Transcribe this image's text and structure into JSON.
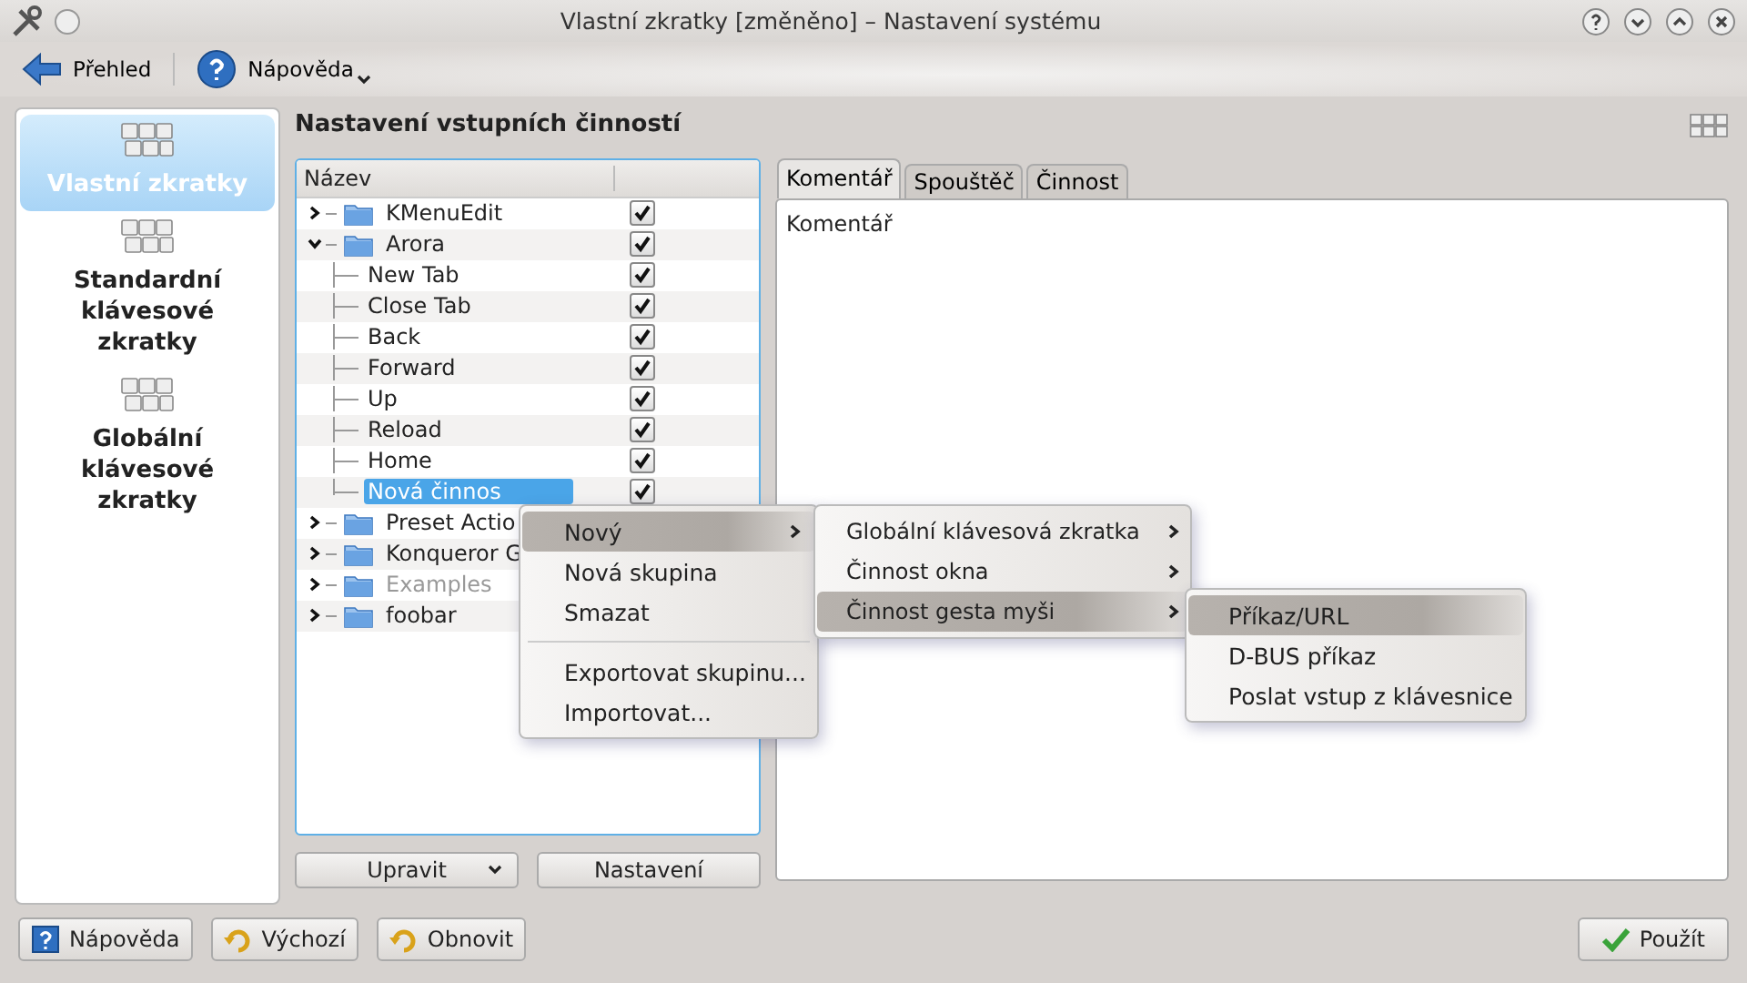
{
  "window": {
    "title": "Vlastní zkratky [změněno] – Nastavení systému"
  },
  "toolbar": [
    {
      "label": "Přehled",
      "kind": "back"
    },
    {
      "label": "Nápověda",
      "kind": "help"
    }
  ],
  "sidebar": {
    "items": [
      {
        "label": "Vlastní zkratky",
        "selected": true
      },
      {
        "label": "Standardní klávesové zkratky",
        "selected": false
      },
      {
        "label": "Globální klávesové zkratky",
        "selected": false
      }
    ]
  },
  "heading": "Nastavení vstupních činností",
  "tree": {
    "column": "Název",
    "items": [
      {
        "label": "KMenuEdit",
        "kind": "folder",
        "expanded": false,
        "checked": true,
        "disabled": false
      },
      {
        "label": "Arora",
        "kind": "folder",
        "expanded": true,
        "checked": true,
        "disabled": false,
        "children": [
          {
            "label": "New Tab",
            "checked": true,
            "disabled": false,
            "selected": false
          },
          {
            "label": "Close Tab",
            "checked": true,
            "disabled": false,
            "selected": false
          },
          {
            "label": "Back",
            "checked": true,
            "disabled": false,
            "selected": false
          },
          {
            "label": "Forward",
            "checked": true,
            "disabled": false,
            "selected": false
          },
          {
            "label": "Up",
            "checked": true,
            "disabled": false,
            "selected": false
          },
          {
            "label": "Reload",
            "checked": true,
            "disabled": false,
            "selected": false
          },
          {
            "label": "Home",
            "checked": true,
            "disabled": false,
            "selected": false
          },
          {
            "label": "Nová činnos",
            "checked": true,
            "disabled": false,
            "selected": true
          }
        ]
      },
      {
        "label": "Preset Actio",
        "kind": "folder",
        "expanded": false,
        "disabled": false
      },
      {
        "label": "Konqueror G",
        "kind": "folder",
        "expanded": false,
        "disabled": false
      },
      {
        "label": "Examples",
        "kind": "folder",
        "expanded": false,
        "disabled": true
      },
      {
        "label": "foobar",
        "kind": "folder",
        "expanded": false,
        "disabled": false
      }
    ]
  },
  "tree_buttons": [
    {
      "label": "Upravit",
      "kind": "dropdown"
    },
    {
      "label": "Nastavení",
      "kind": "plain"
    }
  ],
  "tabs": [
    {
      "label": "Komentář",
      "selected": true
    },
    {
      "label": "Spouštěč",
      "selected": false
    },
    {
      "label": "Činnost",
      "selected": false
    }
  ],
  "comment": "Komentář",
  "context_menu": {
    "items": [
      {
        "label": "Nový",
        "kind": "item",
        "submenu": true,
        "selected": true
      },
      {
        "label": "Nová skupina",
        "kind": "item",
        "submenu": false,
        "selected": false
      },
      {
        "label": "Smazat",
        "kind": "item",
        "submenu": false,
        "selected": false
      },
      {
        "kind": "separator"
      },
      {
        "label": "Exportovat skupinu...",
        "kind": "item",
        "submenu": false,
        "selected": false
      },
      {
        "label": "Importovat...",
        "kind": "item",
        "submenu": false,
        "selected": false
      }
    ]
  },
  "submenu": {
    "items": [
      {
        "label": "Globální klávesová zkratka",
        "kind": "item",
        "submenu": true,
        "selected": false
      },
      {
        "label": "Činnost okna",
        "kind": "item",
        "submenu": true,
        "selected": false
      },
      {
        "label": "Činnost gesta myši",
        "kind": "item",
        "submenu": true,
        "selected": true
      }
    ]
  },
  "submenu_2": {
    "items": [
      {
        "label": "Příkaz/URL",
        "kind": "item",
        "submenu": false,
        "selected": true
      },
      {
        "label": "D-BUS příkaz",
        "kind": "item",
        "submenu": false,
        "selected": false
      },
      {
        "label": "Poslat vstup z klávesnice",
        "kind": "item",
        "submenu": false,
        "selected": false
      }
    ]
  },
  "footer_buttons": [
    {
      "label": "Nápověda",
      "kind": "help"
    },
    {
      "label": "Výchozí",
      "kind": "reset"
    },
    {
      "label": "Obnovit",
      "kind": "reset"
    },
    {
      "label": "Použít",
      "kind": "apply"
    }
  ]
}
